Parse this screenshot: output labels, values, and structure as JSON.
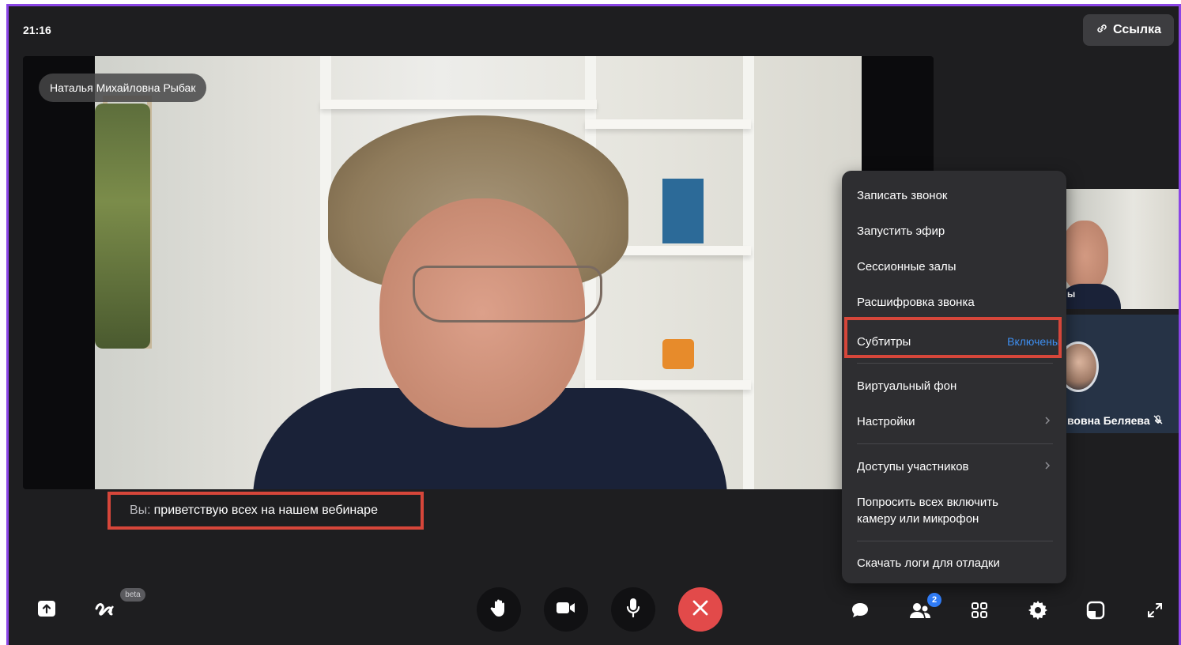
{
  "header": {
    "time": "21:16",
    "link_button_label": "Ссылка"
  },
  "main_video": {
    "speaker_name": "Наталья Михайловна Рыбак"
  },
  "caption": {
    "speaker_prefix": "Вы:",
    "text": "приветствую всех на нашем вебинаре"
  },
  "participants": [
    {
      "name_fragment": "ы"
    },
    {
      "name_fragment": "вовна Беляева"
    }
  ],
  "menu": {
    "items": [
      {
        "label": "Записать звонок"
      },
      {
        "label": "Запустить эфир"
      },
      {
        "label": "Сессионные залы"
      },
      {
        "label": "Расшифровка звонка"
      },
      {
        "label": "Субтитры",
        "state": "Включены"
      },
      {
        "label": "Виртуальный фон"
      },
      {
        "label": "Настройки"
      },
      {
        "label": "Доступы участников"
      },
      {
        "label": "Попросить всех включить камеру или микрофон"
      },
      {
        "label": "Скачать логи для отладки"
      }
    ]
  },
  "toolbar": {
    "beta_label": "beta",
    "participants_count": "2"
  },
  "colors": {
    "accent_border": "#8b45e6",
    "highlight": "#d6463a",
    "end_call": "#e24a4a",
    "link_blue": "#3d8ef0"
  },
  "icons": [
    "link-icon",
    "share-screen-icon",
    "board-icon",
    "raise-hand-icon",
    "camera-icon",
    "microphone-icon",
    "end-call-icon",
    "chat-icon",
    "participants-icon",
    "grid-icon",
    "settings-icon",
    "layout-icon",
    "fullscreen-icon",
    "chevron-right-icon",
    "mic-off-icon"
  ]
}
